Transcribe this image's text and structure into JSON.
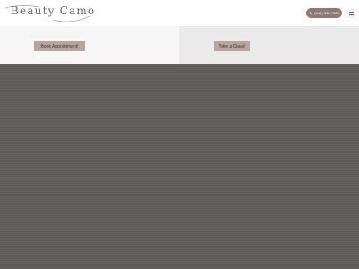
{
  "header": {
    "logo_text": "Beauty Camo",
    "phone_label": "(949) 336-7988",
    "phone_icon": "phone-icon",
    "menu_icon": "hamburger-menu-icon"
  },
  "banners": [
    {
      "cta_label": "Book Appointment!"
    },
    {
      "cta_label": "Take a Class!"
    }
  ],
  "colors": {
    "accent": "#8d7a74",
    "cta_background": "#b7a59f",
    "hero_background": "#5f5c5a"
  }
}
